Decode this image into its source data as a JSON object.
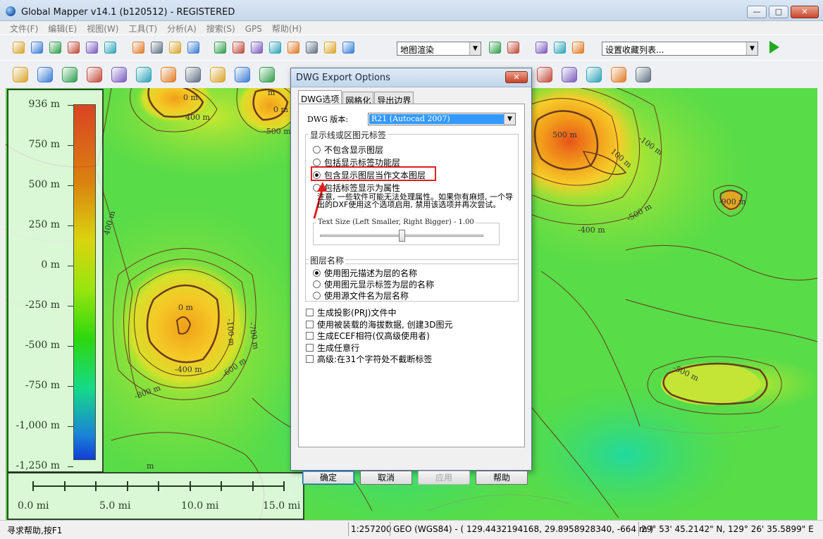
{
  "window": {
    "title": "Global Mapper v14.1 (b120512) - REGISTERED"
  },
  "menu": [
    "文件(F)",
    "编辑(E)",
    "视图(W)",
    "工具(T)",
    "分析(A)",
    "搜索(S)",
    "GPS",
    "帮助(H)"
  ],
  "toolbar": {
    "layer_combo": "地图渲染",
    "favorites_combo": "设置收藏列表...",
    "icons_row1": [
      "open-icon",
      "save-icon",
      "globe-icon",
      "catalog-icon",
      "layers-icon",
      "config-icon",
      "zoom-in-icon",
      "zoom-out-icon",
      "zoom-full-icon",
      "home-icon",
      "select-icon",
      "pan-icon",
      "measure-icon",
      "info-icon",
      "profile-icon",
      "path-icon",
      "draw-icon",
      "binoculars-icon",
      "shader-icon",
      "3d-view-icon",
      "digitizer-icon",
      "overlay-icon",
      "compass-icon"
    ],
    "icons_row2": [
      "area-feature-icon",
      "line-feature-icon",
      "point-feature-icon",
      "vertex-icon",
      "edit-feature-icon",
      "code-icon",
      "move-icon",
      "grid-icon",
      "point-move-icon",
      "line-edit-icon",
      "feature-tool-icon",
      "split-icon",
      "shape-icon",
      "undo-icon",
      "reshape-icon",
      "redo-icon"
    ]
  },
  "legend": {
    "labels": [
      "936 m",
      "750 m",
      "500 m",
      "250 m",
      "0 m",
      "-250 m",
      "-500 m",
      "-750 m",
      "-1,000 m",
      "-1,250 m"
    ]
  },
  "scale": {
    "labels": [
      "0.0 mi",
      "5.0 mi",
      "10.0 mi",
      "15.0 mi"
    ]
  },
  "map": {
    "contour_labels": [
      "0 m",
      "400 m",
      "0 m",
      "-500 m",
      "500 m",
      "-100 m",
      "100 m",
      "-900 m",
      "-400 m",
      "-500 m",
      "400 m",
      "0 m",
      "-100 m",
      "-700 m",
      "-400 m",
      "-600 m",
      "-800 m",
      "-500 m",
      "m",
      "m"
    ]
  },
  "dialog": {
    "title": "DWG Export Options",
    "close": "✕",
    "tabs": [
      "DWG选项",
      "网格化",
      "导出边界"
    ],
    "version_label": "DWG 版本:",
    "version_value": "R21 (Autocad 2007)",
    "display_group": "显示线或区图元标签",
    "display_options": [
      "不包含显示图层",
      "包括显示标签功能层",
      "包含显示图层当作文本图层",
      "包括标签显示为属性"
    ],
    "note": "注意, 一些软件可能无法处理属性。如果你有麻烦, 一个导出的DXF使用这个选项启用, 禁用该选项并再次尝试。",
    "text_size_label": "Text Size (Left Smaller, Right Bigger) - 1.00",
    "text_size_value": 0.5,
    "layer_group": "图层名称",
    "layer_options": [
      "使用图元描述为层的名称",
      "使用图元显示标签为层的名称",
      "使用源文件名为层名称"
    ],
    "checkboxes": [
      "生成投影(PRJ)文件中",
      "使用被装载的海拔数据, 创建3D图元",
      "生成ECEF相符(仅高级使用者)",
      "生成任意行",
      "高级:在31个字符处不截断标签"
    ],
    "buttons": {
      "ok": "确定",
      "cancel": "取消",
      "apply": "应用",
      "help": "帮助"
    }
  },
  "statusbar": {
    "help": "寻求帮助,按F1",
    "scale": "1:257200",
    "coords": "GEO (WGS84) - ( 129.4432194168, 29.8958928340, -664 m )",
    "dms": "29° 53' 45.2142\" N, 129° 26' 35.5899\" E"
  },
  "colors": {
    "highlight": "#e02020",
    "selection": "#3399ff"
  }
}
